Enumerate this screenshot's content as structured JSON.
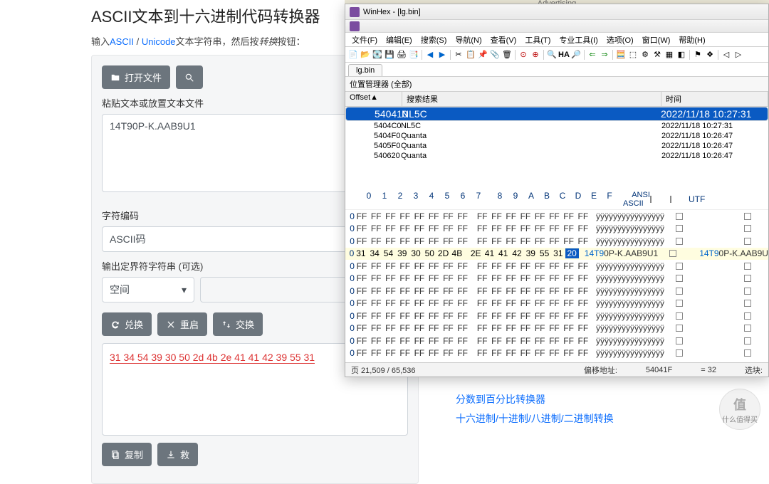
{
  "page": {
    "title": "ASCII文本到十六进制代码转换器",
    "subtitle_pre": "输入",
    "subtitle_link1": "ASCII",
    "subtitle_sep": " / ",
    "subtitle_link2": "Unicode",
    "subtitle_mid": "文本字符串，然后按",
    "subtitle_ital": "转换",
    "subtitle_post": "按钮："
  },
  "toolbar": {
    "open_label": "打开文件",
    "search_label": ""
  },
  "form": {
    "paste_label": "粘贴文本或放置文本文件",
    "input_value": "14T90P-K.AAB9U1",
    "encoding_label": "字符编码",
    "encoding_value": "ASCII码",
    "delim_label": "输出定界符字符串 (可选)",
    "delim_value": "空间",
    "delim_extra": ""
  },
  "actions": {
    "convert": "兑换",
    "reset": "重启",
    "swap": "交换"
  },
  "output": {
    "value": "31 34 54 39 30 50 2d 4b 2e 41 41 42 39 55 31"
  },
  "footer": {
    "copy": "复制",
    "save": "救"
  },
  "rightlinks": {
    "l1": "分数到百分比转换器",
    "l2": "十六进制/十进制/八进制/二进制转换"
  },
  "badge": {
    "big": "值",
    "small": "什么值得买"
  },
  "winhex": {
    "adv": "Advertising",
    "title": "WinHex - [lg.bin]",
    "menu": [
      "文件(F)",
      "编辑(E)",
      "搜索(S)",
      "导航(N)",
      "查看(V)",
      "工具(T)",
      "专业工具(I)",
      "选项(O)",
      "窗口(W)",
      "帮助(H)"
    ],
    "tab": "lg.bin",
    "loc": "位置管理器 (全部)",
    "cols": {
      "offset": "Offset▲",
      "result": "搜索结果",
      "time": "时间"
    },
    "rows": [
      {
        "offset": "540410",
        "result": "NL5C",
        "time": "2022/11/18  10:27:31",
        "sel": true
      },
      {
        "offset": "5404C0",
        "result": "NL5C",
        "time": "2022/11/18  10:27:31"
      },
      {
        "offset": "5404F0",
        "result": "Quanta",
        "time": "2022/11/18  10:26:47"
      },
      {
        "offset": "5405F0",
        "result": "Quanta",
        "time": "2022/11/18  10:26:47"
      },
      {
        "offset": "540620",
        "result": "Quanta",
        "time": "2022/11/18  10:26:47"
      }
    ],
    "hexcols": [
      "0",
      "1",
      "2",
      "3",
      "4",
      "5",
      "6",
      "7",
      "8",
      "9",
      "A",
      "B",
      "C",
      "D",
      "E",
      "F"
    ],
    "asciihead": "ANSI ASCII",
    "utfhead": "UTF",
    "ffrow": {
      "hex": [
        "FF",
        "FF",
        "FF",
        "FF",
        "FF",
        "FF",
        "FF",
        "FF",
        "FF",
        "FF",
        "FF",
        "FF",
        "FF",
        "FF",
        "FF",
        "FF"
      ],
      "asc": "ÿÿÿÿÿÿÿÿÿÿÿÿÿÿÿÿ"
    },
    "datarow": {
      "hex": [
        "31",
        "34",
        "54",
        "39",
        "30",
        "50",
        "2D",
        "4B",
        "2E",
        "41",
        "41",
        "42",
        "39",
        "55",
        "31",
        "20"
      ],
      "asc1": "14T9",
      "asc2": "0P-K.AAB9U1",
      "asc3": "14T9",
      "asc4": "0P-K.AAB9U"
    },
    "ffcount_before": 3,
    "ffcount_after": 8,
    "status": {
      "page": "页 21,509 / 65,536",
      "offlbl": "偏移地址:",
      "off": "54041F",
      "eq": "= 32",
      "sel": "选块:"
    }
  }
}
